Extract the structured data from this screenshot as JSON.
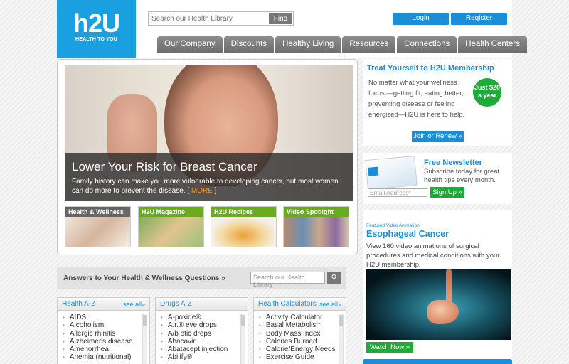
{
  "logo": {
    "mark": "h2U",
    "tagline": "HEALTH TO YOU"
  },
  "search": {
    "placeholder": "Search our Health Library",
    "button": "Find"
  },
  "account": {
    "login": "Login",
    "register": "Register"
  },
  "nav": [
    "Our Company",
    "Discounts",
    "Healthy Living",
    "Resources",
    "Connections",
    "Health Centers"
  ],
  "hero": {
    "title": "Lower Your Risk for Breast Cancer",
    "text": "Family history can make you more vulnerable to developing cancer, but most women can do more to prevent the disease.",
    "more_open": "[ ",
    "more": "MORE",
    "more_close": " ]"
  },
  "thumbs": [
    {
      "label": "Health & Wellness",
      "color": "#666666"
    },
    {
      "label": "H2U Magazine",
      "color": "#6aaa1f"
    },
    {
      "label": "H2U Recipes",
      "color": "#6aaa1f"
    },
    {
      "label": "Video Spotlight",
      "color": "#6aaa1f"
    }
  ],
  "qa": {
    "title": "Answers to Your Health & Wellness Questions »",
    "placeholder": "Search our Health Library"
  },
  "lists": [
    {
      "title": "Health A-Z",
      "see_all": "see all»",
      "items": [
        "AIDS",
        "Alcoholism",
        "Allergic rhinitis",
        "Alzheimer's disease",
        "Amenorrhea",
        "Anemia (nutritional)"
      ]
    },
    {
      "title": "Drugs A-Z",
      "see_all": "",
      "items": [
        "A-poxide®",
        "A.r.® eye drops",
        "A/b otic drops",
        "Abacavir",
        "Abatacept injection",
        "Abilify®"
      ]
    },
    {
      "title": "Health Calculators",
      "see_all": "see all»",
      "items": [
        "Activity Calculator",
        "Basal Metabolism",
        "Body Mass Index",
        "Calories Burned",
        "Calorie/Energy Needs",
        "Exercise Guide"
      ]
    }
  ],
  "membership": {
    "title": "Treat Yourself to H2U Membership",
    "text": "No matter what your wellness focus —getting fit, eating better, preventing disease or feeling energized—H2U is here to help.",
    "badge_line1": "Just $20",
    "badge_line2": "a year",
    "button": "Join or Renew »"
  },
  "newsletter": {
    "title": "Free Newsletter",
    "text": "Subscribe today for great health tips every month.",
    "email_placeholder": "Email Address*",
    "button": "Sign Up »"
  },
  "video": {
    "kicker": "Featured Video Animation",
    "title": "Esophageal Cancer",
    "text": "View 160 video animations of surgical procedures and medical conditions with your H2U membership.",
    "button": "Watch Now »"
  }
}
